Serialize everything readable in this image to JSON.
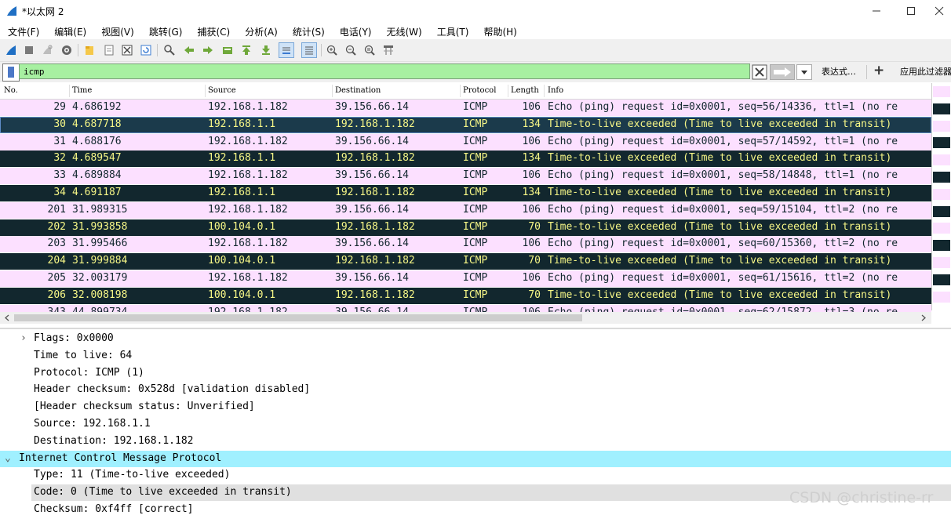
{
  "window": {
    "title": "*以太网 2"
  },
  "menu": [
    "文件(F)",
    "编辑(E)",
    "视图(V)",
    "跳转(G)",
    "捕获(C)",
    "分析(A)",
    "统计(S)",
    "电话(Y)",
    "无线(W)",
    "工具(T)",
    "帮助(H)"
  ],
  "toolbar": {
    "icons": [
      "shark-fin-start-icon",
      "stop-icon",
      "restart-icon",
      "options-gear-icon",
      "open-folder-icon",
      "file-icon",
      "close-file-icon",
      "reload-icon",
      "find-icon",
      "back-arrow-icon",
      "forward-arrow-icon",
      "goto-packet-icon",
      "first-packet-icon",
      "last-packet-icon",
      "autoscroll-icon",
      "colorize-icon",
      "zoom-in-icon",
      "zoom-out-icon",
      "zoom-normal-icon",
      "resize-columns-icon"
    ]
  },
  "filter": {
    "value": "icmp",
    "expression_label": "表达式…",
    "add_label": "+",
    "button_label": "应用此过滤器"
  },
  "packet_list": {
    "columns": [
      "No.",
      "Time",
      "Source",
      "Destination",
      "Protocol",
      "Length",
      "Info"
    ],
    "rows": [
      {
        "no": "29",
        "time": "4.686192",
        "source": "192.168.1.182",
        "destination": "39.156.66.14",
        "protocol": "ICMP",
        "length": "106",
        "info": "Echo (ping) request  id=0x0001, seq=56/14336, ttl=1 (no re",
        "kind": "req"
      },
      {
        "no": "30",
        "time": "4.687718",
        "source": "192.168.1.1",
        "destination": "192.168.1.182",
        "protocol": "ICMP",
        "length": "134",
        "info": "Time-to-live exceeded (Time to live exceeded in transit)",
        "kind": "exc-sel"
      },
      {
        "no": "31",
        "time": "4.688176",
        "source": "192.168.1.182",
        "destination": "39.156.66.14",
        "protocol": "ICMP",
        "length": "106",
        "info": "Echo (ping) request  id=0x0001, seq=57/14592, ttl=1 (no re",
        "kind": "req"
      },
      {
        "no": "32",
        "time": "4.689547",
        "source": "192.168.1.1",
        "destination": "192.168.1.182",
        "protocol": "ICMP",
        "length": "134",
        "info": "Time-to-live exceeded (Time to live exceeded in transit)",
        "kind": "exc"
      },
      {
        "no": "33",
        "time": "4.689884",
        "source": "192.168.1.182",
        "destination": "39.156.66.14",
        "protocol": "ICMP",
        "length": "106",
        "info": "Echo (ping) request  id=0x0001, seq=58/14848, ttl=1 (no re",
        "kind": "req"
      },
      {
        "no": "34",
        "time": "4.691187",
        "source": "192.168.1.1",
        "destination": "192.168.1.182",
        "protocol": "ICMP",
        "length": "134",
        "info": "Time-to-live exceeded (Time to live exceeded in transit)",
        "kind": "exc"
      },
      {
        "no": "201",
        "time": "31.989315",
        "source": "192.168.1.182",
        "destination": "39.156.66.14",
        "protocol": "ICMP",
        "length": "106",
        "info": "Echo (ping) request  id=0x0001, seq=59/15104, ttl=2 (no re",
        "kind": "req"
      },
      {
        "no": "202",
        "time": "31.993858",
        "source": "100.104.0.1",
        "destination": "192.168.1.182",
        "protocol": "ICMP",
        "length": "70",
        "info": "Time-to-live exceeded (Time to live exceeded in transit)",
        "kind": "exc"
      },
      {
        "no": "203",
        "time": "31.995466",
        "source": "192.168.1.182",
        "destination": "39.156.66.14",
        "protocol": "ICMP",
        "length": "106",
        "info": "Echo (ping) request  id=0x0001, seq=60/15360, ttl=2 (no re",
        "kind": "req"
      },
      {
        "no": "204",
        "time": "31.999884",
        "source": "100.104.0.1",
        "destination": "192.168.1.182",
        "protocol": "ICMP",
        "length": "70",
        "info": "Time-to-live exceeded (Time to live exceeded in transit)",
        "kind": "exc"
      },
      {
        "no": "205",
        "time": "32.003179",
        "source": "192.168.1.182",
        "destination": "39.156.66.14",
        "protocol": "ICMP",
        "length": "106",
        "info": "Echo (ping) request  id=0x0001, seq=61/15616, ttl=2 (no re",
        "kind": "req"
      },
      {
        "no": "206",
        "time": "32.008198",
        "source": "100.104.0.1",
        "destination": "192.168.1.182",
        "protocol": "ICMP",
        "length": "70",
        "info": "Time-to-live exceeded (Time to live exceeded in transit)",
        "kind": "exc"
      },
      {
        "no": "343",
        "time": "44.899734",
        "source": "192.168.1.182",
        "destination": "39.156.66.14",
        "protocol": "ICMP",
        "length": "106",
        "info": "Echo (ping) request  id=0x0001, seq=62/15872, ttl=3 (no re",
        "kind": "req"
      }
    ]
  },
  "details": {
    "lines": [
      {
        "text": "Flags: 0x0000",
        "expander": "›",
        "kind": "child"
      },
      {
        "text": "Time to live: 64",
        "expander": "",
        "kind": "child"
      },
      {
        "text": "Protocol: ICMP (1)",
        "expander": "",
        "kind": "child"
      },
      {
        "text": "Header checksum: 0x528d [validation disabled]",
        "expander": "",
        "kind": "child"
      },
      {
        "text": "[Header checksum status: Unverified]",
        "expander": "",
        "kind": "child"
      },
      {
        "text": "Source: 192.168.1.1",
        "expander": "",
        "kind": "child"
      },
      {
        "text": "Destination: 192.168.1.182",
        "expander": "",
        "kind": "child"
      },
      {
        "text": "Internet Control Message Protocol",
        "expander": "⌄",
        "kind": "proto"
      },
      {
        "text": "Type: 11 (Time-to-live exceeded)",
        "expander": "",
        "kind": "child"
      },
      {
        "text": "Code: 0 (Time to live exceeded in transit)",
        "expander": "",
        "kind": "selected"
      },
      {
        "text": "Checksum: 0xf4ff [correct]",
        "expander": "",
        "kind": "child"
      }
    ]
  },
  "watermark": "CSDN @christine-rr",
  "colors": {
    "request_bg": "#fce0ff",
    "exceeded_bg": "#12272e",
    "exceeded_fg": "#f7f787",
    "filter_bg": "#a7f0a1",
    "proto_bg": "#a0f0ff"
  }
}
